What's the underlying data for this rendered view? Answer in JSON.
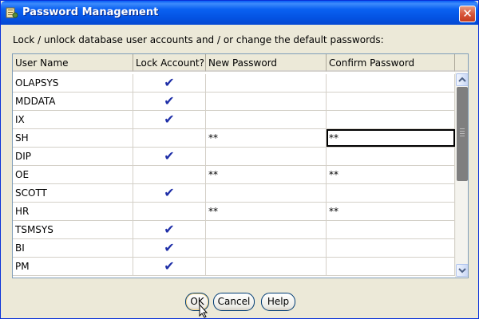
{
  "window": {
    "title": "Password Management",
    "close_label": "✕"
  },
  "instructions": "Lock / unlock database user accounts and / or change the default passwords:",
  "grid": {
    "columns": [
      "User Name",
      "Lock Account?",
      "New Password",
      "Confirm Password"
    ],
    "rows": [
      {
        "user": "OLAPSYS",
        "locked": "✔",
        "new_password": "",
        "confirm_password": ""
      },
      {
        "user": "MDDATA",
        "locked": "✔",
        "new_password": "",
        "confirm_password": ""
      },
      {
        "user": "IX",
        "locked": "✔",
        "new_password": "",
        "confirm_password": ""
      },
      {
        "user": "SH",
        "locked": "",
        "new_password": "**",
        "confirm_password": "**"
      },
      {
        "user": "DIP",
        "locked": "✔",
        "new_password": "",
        "confirm_password": ""
      },
      {
        "user": "OE",
        "locked": "",
        "new_password": "**",
        "confirm_password": "**"
      },
      {
        "user": "SCOTT",
        "locked": "✔",
        "new_password": "",
        "confirm_password": ""
      },
      {
        "user": "HR",
        "locked": "",
        "new_password": "**",
        "confirm_password": "**"
      },
      {
        "user": "TSMSYS",
        "locked": "✔",
        "new_password": "",
        "confirm_password": ""
      },
      {
        "user": "BI",
        "locked": "✔",
        "new_password": "",
        "confirm_password": ""
      },
      {
        "user": "PM",
        "locked": "✔",
        "new_password": "",
        "confirm_password": ""
      }
    ]
  },
  "buttons": {
    "ok": "OK",
    "cancel": "Cancel",
    "help": "Help"
  },
  "colors": {
    "titlebar": "#0453E3",
    "checkmark": "#1F2FA8",
    "dialog_bg": "#ECE9D8"
  }
}
